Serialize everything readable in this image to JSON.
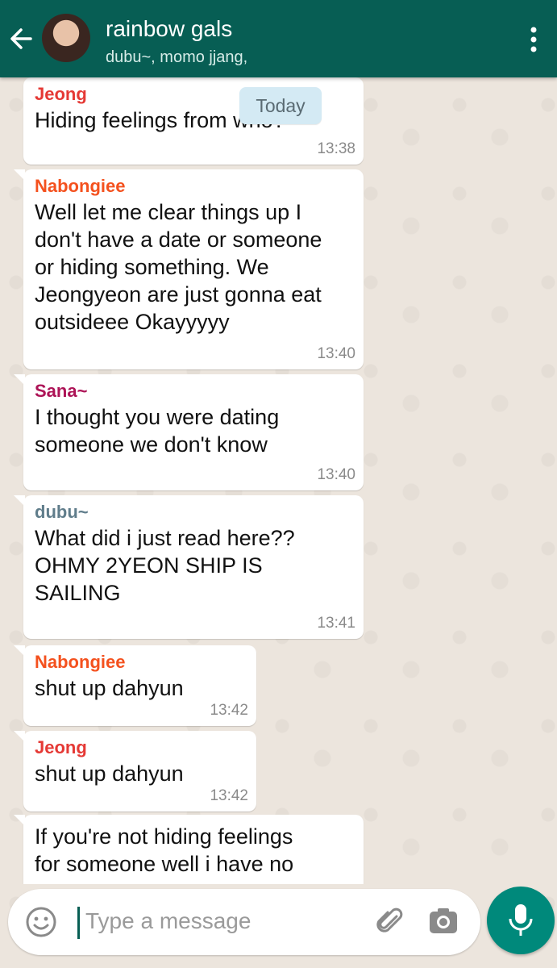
{
  "header": {
    "title": "rainbow gals",
    "subtitle": "dubu~, momo jjang,",
    "color": "#075e54"
  },
  "date_chip": "Today",
  "messages": [
    {
      "sender": "Jeong",
      "sender_color": "#e53935",
      "text": "Hiding feelings from who?",
      "time": "13:38"
    },
    {
      "sender": "Nabongiee",
      "sender_color": "#f4511e",
      "text": "Well let me clear things up I\ndon't have a date or someone\nor hiding something. We\nJeongyeon are just gonna eat\noutsideee Okayyyyy",
      "time": "13:40"
    },
    {
      "sender": "Sana~",
      "sender_color": "#ad1457",
      "text": "I thought you were dating\nsomeone we don't know",
      "time": "13:40"
    },
    {
      "sender": "dubu~",
      "sender_color": "#607d8b",
      "text": "What did i just read here??\nOHMY 2YEON SHIP IS\nSAILING",
      "time": "13:41"
    },
    {
      "sender": "Nabongiee",
      "sender_color": "#f4511e",
      "text": "shut up dahyun",
      "time": "13:42"
    },
    {
      "sender": "Jeong",
      "sender_color": "#e53935",
      "text": "shut up dahyun",
      "time": "13:42"
    },
    {
      "sender": "",
      "sender_color": "",
      "text": "If you're not hiding feelings\nfor someone well i have no",
      "time": ""
    }
  ],
  "composer": {
    "placeholder": "Type a message"
  },
  "icons": {
    "back": "arrow-left-icon",
    "menu": "more-vert-icon",
    "emoji": "emoji-icon",
    "attach": "paperclip-icon",
    "camera": "camera-icon",
    "mic": "microphone-icon"
  }
}
